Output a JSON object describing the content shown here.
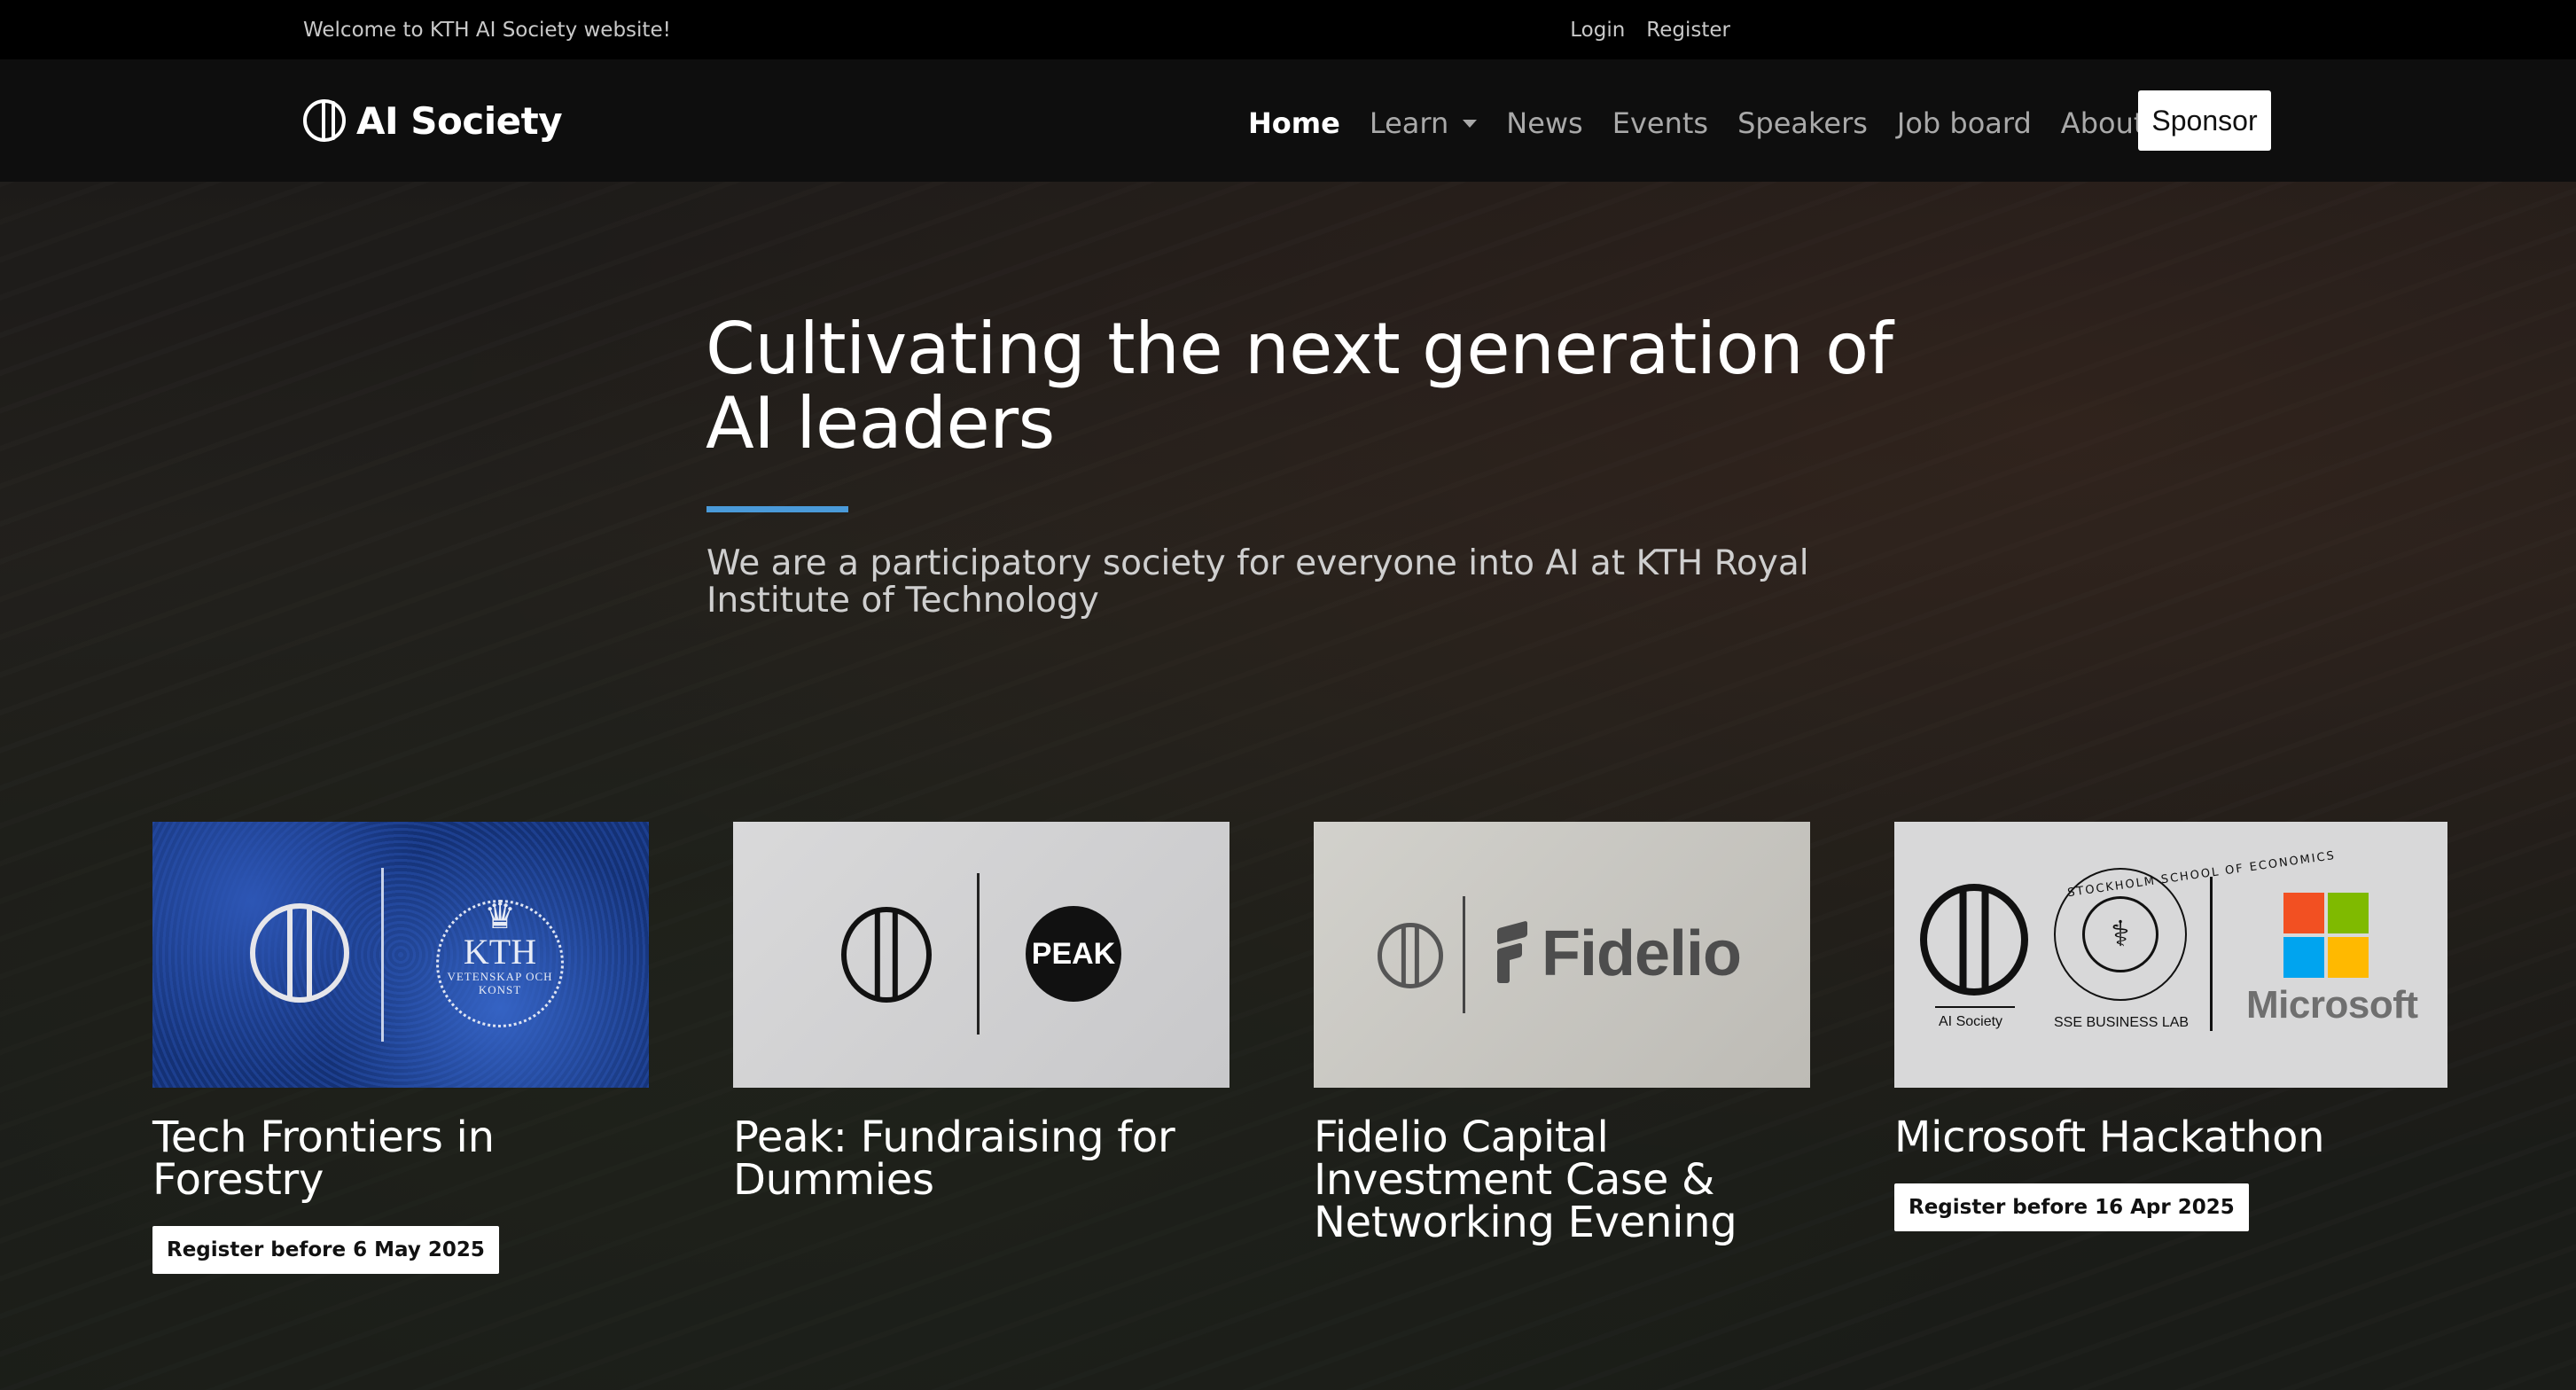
{
  "topbar": {
    "welcome": "Welcome to KTH AI Society website!",
    "login": "Login",
    "register": "Register"
  },
  "nav": {
    "brand": "AI Society",
    "items": [
      {
        "label": "Home",
        "active": true,
        "dropdown": false
      },
      {
        "label": "Learn",
        "active": false,
        "dropdown": true
      },
      {
        "label": "News",
        "active": false,
        "dropdown": false
      },
      {
        "label": "Events",
        "active": false,
        "dropdown": false
      },
      {
        "label": "Speakers",
        "active": false,
        "dropdown": false
      },
      {
        "label": "Job board",
        "active": false,
        "dropdown": false
      },
      {
        "label": "About",
        "active": false,
        "dropdown": true
      }
    ],
    "sponsor": "Sponsor"
  },
  "hero": {
    "title": "Cultivating the next generation of AI leaders",
    "subtitle": "We are a participatory society for everyone into AI at KTH Royal Institute of Technology",
    "accent_color": "#4a9ad9"
  },
  "cards": [
    {
      "title": "Tech Frontiers in Forestry",
      "badge": "Register before 6 May 2025",
      "logo": {
        "kth": "KTH",
        "kth_sub": "VETENSKAP OCH KONST"
      }
    },
    {
      "title": "Peak: Fundraising for Dummies",
      "badge": "",
      "logo": {
        "peak": "PEAK"
      }
    },
    {
      "title": "Fidelio Capital Investment Case & Networking Evening",
      "badge": "",
      "logo": {
        "fidelio": "Fidelio"
      }
    },
    {
      "title": "Microsoft Hackathon",
      "badge": "Register before 16 Apr 2025",
      "logo": {
        "ai_society": "AI Society",
        "sse_ring": "STOCKHOLM SCHOOL OF ECONOMICS",
        "sse_caption": "SSE BUSINESS LAB",
        "microsoft": "Microsoft",
        "ms_colors": [
          "#f25022",
          "#7fba00",
          "#00a4ef",
          "#ffb900"
        ]
      }
    }
  ]
}
